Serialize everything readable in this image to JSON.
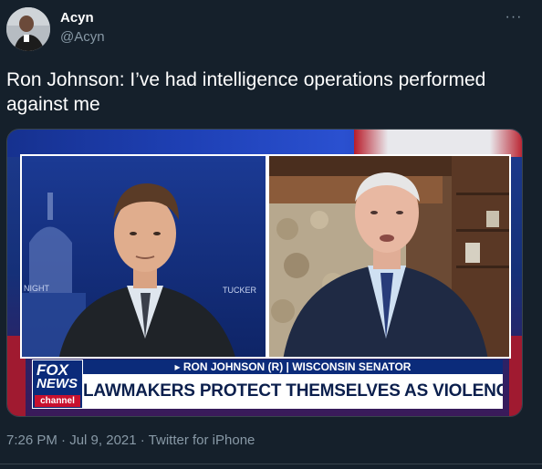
{
  "author": {
    "name": "Acyn",
    "handle": "@Acyn"
  },
  "more_icon": "more-horizontal-icon",
  "more_glyph": "···",
  "tweet": {
    "text": "Ron Johnson: I’ve had intelligence operations performed against me"
  },
  "video": {
    "network_logo": {
      "line1": "FOX",
      "line2": "NEWS",
      "line3": "channel"
    },
    "chyron_name": "▸ RON JOHNSON (R) | WISCONSIN SENATOR",
    "chyron_headline": "LAWMAKERS PROTECT THEMSELVES AS VIOLENCE GROWS",
    "left_backdrop_label_1": "NIGHT",
    "left_backdrop_label_2": "TUCKER"
  },
  "meta": {
    "time": "7:26 PM",
    "separator": " · ",
    "date": "Jul 9, 2021",
    "source": "Twitter for iPhone"
  },
  "colors": {
    "background": "#15202b",
    "secondary_text": "#8899a6",
    "fox_blue": "#0b2b7a",
    "fox_red": "#c8102e"
  }
}
